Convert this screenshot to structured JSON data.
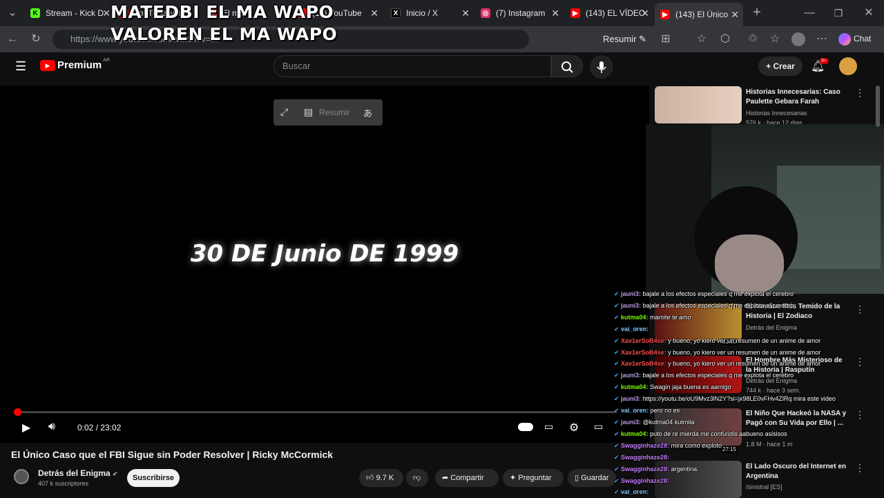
{
  "browser": {
    "tabs": [
      {
        "label": "Stream - Kick D",
        "favicon_color": "#53fc18"
      },
      {
        "label": "YouTube Mu",
        "favicon_color": "#ff0000"
      },
      {
        "label": "El me",
        "favicon_color": "#ff0000"
      },
      {
        "label": "(13) YouTube",
        "favicon_color": "#ff0000"
      },
      {
        "label": "Inicio / X",
        "favicon_color": "#000000"
      },
      {
        "label": "(7) Instagram",
        "favicon_color": "#e1306c"
      },
      {
        "label": "(143) EL VÍDEO",
        "favicon_color": "#ff0000"
      },
      {
        "label": "(143) El Único",
        "favicon_color": "#ff0000"
      }
    ],
    "url": "https://www.youtube.com/watch?v=...",
    "resumir_label": "Resumir",
    "chat_label": "Chat"
  },
  "overlay": {
    "line1": "MATEDBI EL MA WAPO",
    "line2": "VALOREN EL MA WAPO"
  },
  "youtube": {
    "brand": "Premium",
    "region": "AR",
    "search_placeholder": "Buscar",
    "create_label": "Crear",
    "notif_badge": "9+"
  },
  "video": {
    "frame_text": "30 DE Junio DE 1999",
    "toolbar_label": "Resumir",
    "time": "0:02 / 23:02",
    "progress": 0.0015,
    "title": "El Único Caso que el FBI Sigue sin Poder Resolver | Ricky McCormick",
    "channel": "Detrás del Enigma",
    "subscribers": "407 k suscriptores",
    "subscribe_label": "Suscribirse",
    "likes": "9.7 K",
    "share_label": "Compartir",
    "ask_label": "Preguntar",
    "save_label": "Guardar"
  },
  "sidebar": [
    {
      "title": "Historias Innecesarias: Caso Paulette Gebara Farah",
      "channel": "Historias Innecesarias",
      "meta": "576 k · hace 12 días"
    },
    {
      "title": "El Asesino Más Temido de la Historia | El Zodiaco",
      "channel": "Detrás del Enigma",
      "meta": "",
      "duration": "33:50"
    },
    {
      "title": "El Hombre Más Misterioso de la Historia | Rasputín",
      "channel": "Detrás del Enigma",
      "meta": "744 k · hace 3 sem."
    },
    {
      "title": "El Niño Que Hackeó la NASA y Pagó con Su Vida por Ello | ...",
      "channel": "",
      "meta": "1.8 M · hace 1 m",
      "duration": "27:15"
    },
    {
      "title": "El Lado Oscuro del Internet en Argentina",
      "channel": "/sinistral [ES]",
      "meta": ""
    }
  ],
  "chat": [
    {
      "user": "jauni3:",
      "text": " bajale a los efectos especiales q me explota el cerebro",
      "color": "#b39ddb"
    },
    {
      "user": "jauni3:",
      "text": " bajale a los efectos especiales q me explota el cerebro",
      "color": "#b39ddb"
    },
    {
      "user": "kutma04:",
      "text": " mamite te amo",
      "color": "#7cfc00"
    },
    {
      "user": "vai_oren:",
      "text": "",
      "color": "#7ec8ff"
    },
    {
      "user": "Xav1erSoB4se:",
      "text": " y bueno, yo kiero ver un resumen de un anime de amor",
      "color": "#ff4d4d"
    },
    {
      "user": "Xav1erSoB4se:",
      "text": " y bueno, yo kiero ver un resumen de un anime de amor",
      "color": "#ff4d4d"
    },
    {
      "user": "Xav1erSoB4se:",
      "text": " y bueno, yo kiero ver un resumen de un anime de amor",
      "color": "#ff4d4d"
    },
    {
      "user": "jauni3:",
      "text": " bajale a los efectos especiales q me explota el cerebro",
      "color": "#b39ddb"
    },
    {
      "user": "kutma04:",
      "text": " Swagin jaja buena es aamigo",
      "color": "#7cfc00"
    },
    {
      "user": "jauni3:",
      "text": " https://youtu.be/oU9Mvz3lN2Y?si=jx98LE0vFHv4ZlRq mira este video",
      "color": "#b39ddb"
    },
    {
      "user": "vai_oren:",
      "text": " pero no es",
      "color": "#7ec8ff"
    },
    {
      "user": "jauni3:",
      "text": " @kutma04 kutmila",
      "color": "#b39ddb"
    },
    {
      "user": "kutma04:",
      "text": " puto de re mierda me confundis aabueno asisisos",
      "color": "#7cfc00"
    },
    {
      "user": "Swagginhaze28:",
      "text": " mira como exploto",
      "color": "#c77dff"
    },
    {
      "user": "Swagginhaze28:",
      "text": "",
      "color": "#c77dff"
    },
    {
      "user": "Swagginhaze28:",
      "text": " argentina.",
      "color": "#c77dff"
    },
    {
      "user": "Swagginhaze28:",
      "text": "",
      "color": "#c77dff"
    },
    {
      "user": "vai_oren:",
      "text": "",
      "color": "#7ec8ff"
    }
  ]
}
